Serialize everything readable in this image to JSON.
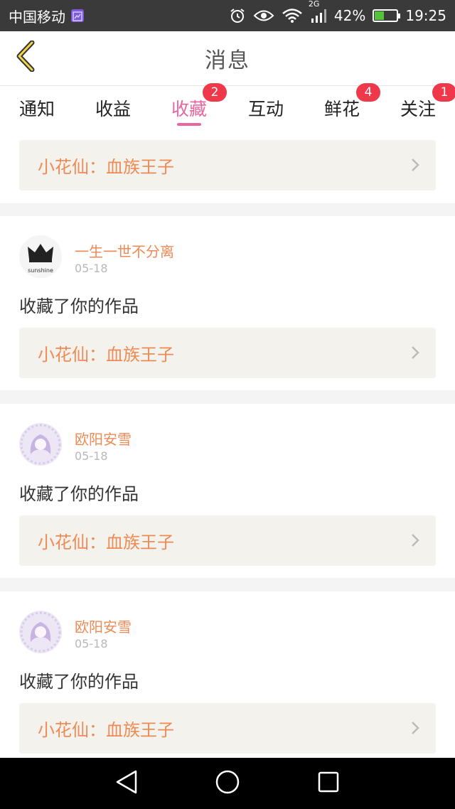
{
  "status_bar": {
    "carrier": "中国移动",
    "network": "2G",
    "battery": "42%",
    "battery_level": 0.42,
    "time": "19:25",
    "icons": [
      "app-notification-icon",
      "alarm-icon",
      "eye-icon",
      "wifi-icon",
      "signal-icon",
      "battery-icon"
    ]
  },
  "header": {
    "title": "消息",
    "back_icon": "chevron-left-icon"
  },
  "tabs": [
    {
      "label": "通知",
      "badge": ""
    },
    {
      "label": "收益",
      "badge": ""
    },
    {
      "label": "收藏",
      "badge": "2",
      "active": true
    },
    {
      "label": "互动",
      "badge": ""
    },
    {
      "label": "鲜花",
      "badge": "4"
    },
    {
      "label": "关注",
      "badge": "1"
    }
  ],
  "colors": {
    "accent": "#e8679d",
    "orange_text": "#ee8a55",
    "badge": "#f0384b",
    "link_bg": "#f4f2ec"
  },
  "feed": {
    "first_link": "小花仙：血族王子",
    "items": [
      {
        "user": "一生一世不分离",
        "date": "05-18",
        "action": "收藏了你的作品",
        "work": "小花仙：血族王子",
        "avatar_text": "sunshine"
      },
      {
        "user": "欧阳安雪",
        "date": "05-18",
        "action": "收藏了你的作品",
        "work": "小花仙：血族王子"
      },
      {
        "user": "欧阳安雪",
        "date": "05-18",
        "action": "收藏了你的作品",
        "work": "小花仙：血族王子"
      }
    ]
  },
  "nav": {
    "back": "triangle-back-icon",
    "home": "circle-home-icon",
    "recent": "square-recent-icon"
  }
}
